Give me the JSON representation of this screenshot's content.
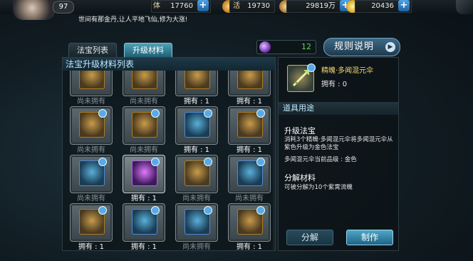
{
  "top": {
    "level": "97",
    "resources": [
      {
        "label": "体",
        "value": "17760",
        "has_plus": true
      },
      {
        "label": "活",
        "value": "19730",
        "has_plus": false
      },
      {
        "label": "",
        "value": "29819万",
        "has_plus": true
      },
      {
        "label": "",
        "value": "20436",
        "has_plus": true
      }
    ],
    "marquee": "世间有那金丹,让人平地飞仙,修为大涨!"
  },
  "tabs": [
    {
      "label": "法宝列表",
      "active": false
    },
    {
      "label": "升级材料",
      "active": true
    }
  ],
  "crystal_count": "12",
  "rules_label": "规则说明",
  "list_title": "法宝升级材料列表",
  "items": [
    {
      "caption": "尚未拥有",
      "owned": false,
      "frame": "gold"
    },
    {
      "caption": "尚未拥有",
      "owned": false,
      "frame": "gold"
    },
    {
      "caption": "拥有 : 1",
      "owned": true,
      "frame": "gold"
    },
    {
      "caption": "拥有 : 1",
      "owned": true,
      "frame": "gold"
    },
    {
      "caption": "尚未拥有",
      "owned": false,
      "frame": "gold"
    },
    {
      "caption": "尚未拥有",
      "owned": false,
      "frame": "gold"
    },
    {
      "caption": "拥有 : 1",
      "owned": true,
      "frame": "blue"
    },
    {
      "caption": "拥有 : 1",
      "owned": true,
      "frame": "gold"
    },
    {
      "caption": "尚未拥有",
      "owned": false,
      "frame": "blue"
    },
    {
      "caption": "拥有 : 1",
      "owned": true,
      "frame": "purple",
      "selected": true
    },
    {
      "caption": "尚未拥有",
      "owned": false,
      "frame": "gold"
    },
    {
      "caption": "尚未拥有",
      "owned": false,
      "frame": "blue"
    },
    {
      "caption": "拥有 : 1",
      "owned": true,
      "frame": "gold"
    },
    {
      "caption": "拥有 : 1",
      "owned": true,
      "frame": "blue"
    },
    {
      "caption": "尚未拥有",
      "owned": false,
      "frame": "blue"
    },
    {
      "caption": "拥有 : 1",
      "owned": true,
      "frame": "gold"
    }
  ],
  "detail": {
    "name": "精魄·多闻混元伞",
    "owned": "拥有 : 0",
    "section_title": "道具用途",
    "upgrade_heading": "升级法宝",
    "upgrade_text": "消耗3个精魄·多闻混元伞将多闻混元伞从紫色升级为金色法宝",
    "quality_text": "多闻混元伞当前品级 : 金色",
    "decompose_heading": "分解材料",
    "decompose_text": "可被分解为10个紫霄流魄"
  },
  "buttons": {
    "decompose": "分解",
    "craft": "制作"
  },
  "colors": {
    "accent": "#4fa6c6",
    "owned_text": "#ffffff",
    "unowned_text": "#8a9399",
    "item_name": "#f3d56a",
    "crystal_count": "#4fdf4f"
  }
}
